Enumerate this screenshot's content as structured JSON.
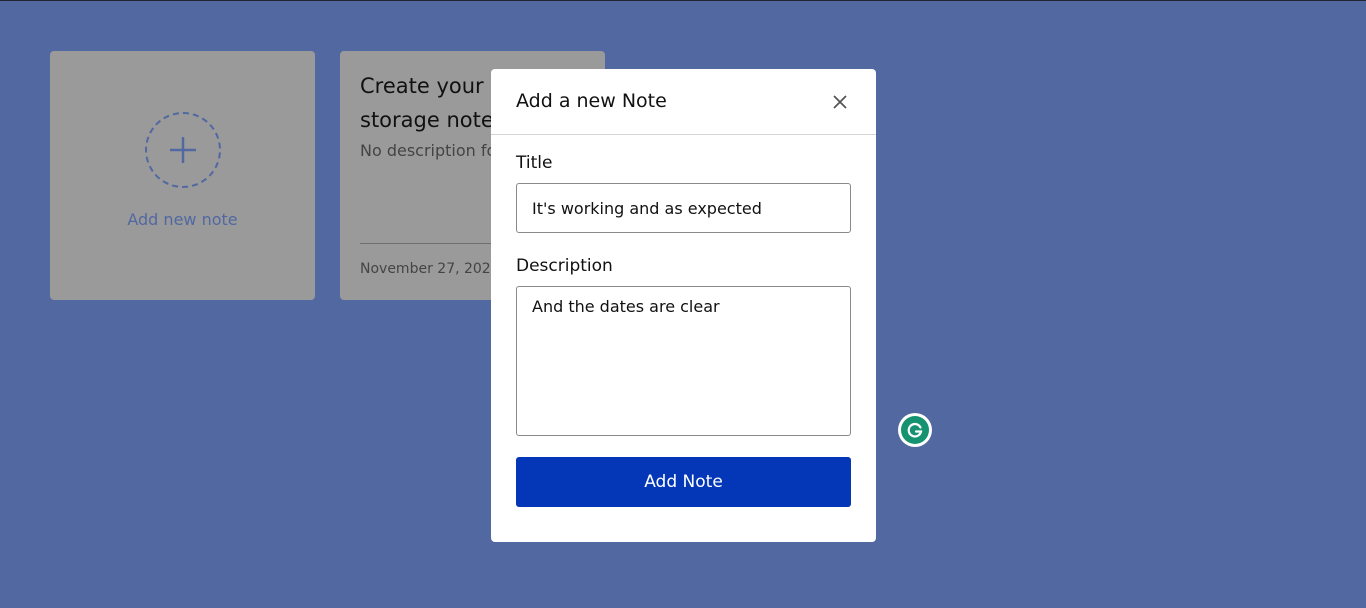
{
  "notes_board": {
    "add_card_label": "Add new note",
    "note": {
      "title": "Create your Local JS storage notes app",
      "description": "No description found",
      "date": "November 27, 2023"
    }
  },
  "modal": {
    "title": "Add a new Note",
    "close_icon": "close-icon",
    "title_label": "Title",
    "title_value": "It's working and as expected",
    "description_label": "Description",
    "description_value": "And the dates are clear",
    "submit_label": "Add Note"
  },
  "extension": {
    "icon": "grammarly-icon"
  },
  "colors": {
    "background": "#5168a0",
    "card_dimmed": "#9a9a9a",
    "accent": "#0437b8",
    "grammarly": "#15926f"
  }
}
